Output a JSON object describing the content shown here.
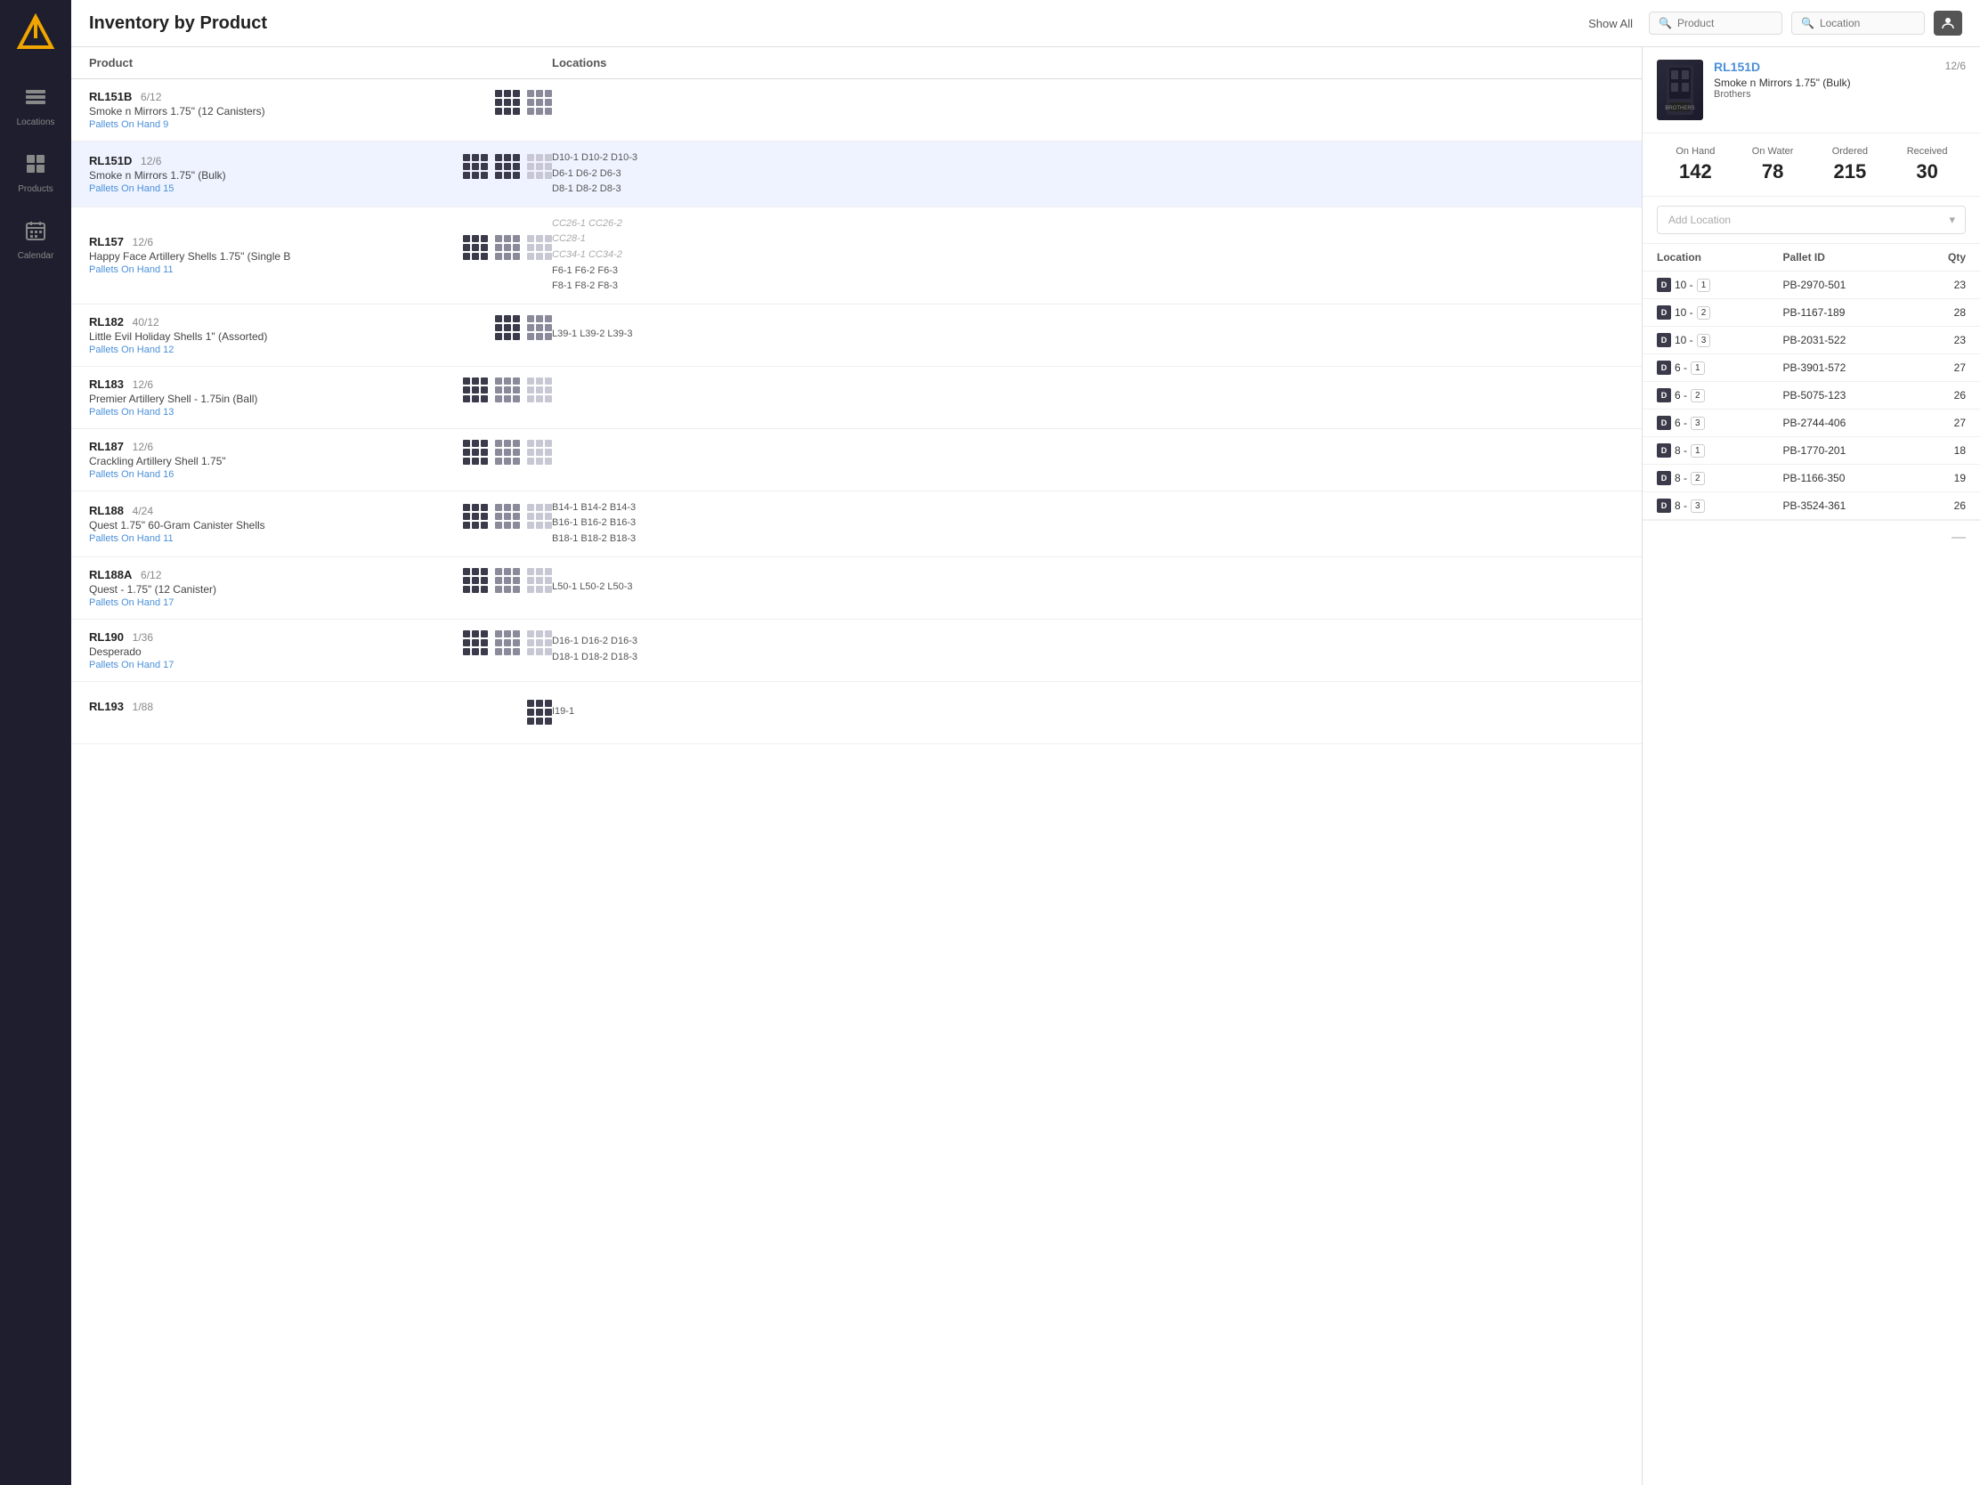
{
  "app": {
    "title": "Inventory by Product",
    "show_all_label": "Show All"
  },
  "header": {
    "product_placeholder": "Product",
    "location_placeholder": "Location"
  },
  "sidebar": {
    "logo_alt": "Logo",
    "items": [
      {
        "id": "locations",
        "label": "Locations",
        "icon": "⬡"
      },
      {
        "id": "products",
        "label": "Products",
        "icon": "⬡"
      },
      {
        "id": "calendar",
        "label": "Calendar",
        "icon": "▦"
      }
    ]
  },
  "table": {
    "col_product": "Product",
    "col_locations": "Locations"
  },
  "products": [
    {
      "code": "RL151B",
      "ratio": "6/12",
      "name": "Smoke n Mirrors 1.75\" (12 Canisters)",
      "pallets": "Pallets On Hand 9",
      "locations": [],
      "grids": [
        "dark",
        "med",
        "empty"
      ]
    },
    {
      "code": "RL151D",
      "ratio": "12/6",
      "name": "Smoke n Mirrors 1.75\" (Bulk)",
      "pallets": "Pallets On Hand 15",
      "locations": [
        "D10-1 D10-2 D10-3",
        "D6-1 D6-2 D6-3",
        "D8-1 D8-2 D8-3"
      ],
      "grids": [
        "dark",
        "dark",
        "light"
      ],
      "selected": true
    },
    {
      "code": "RL157",
      "ratio": "12/6",
      "name": "Happy Face Artillery Shells 1.75\" (Single B",
      "pallets": "Pallets On Hand 11",
      "locations": [
        "CC26-1 CC26-2",
        "CC28-1",
        "CC34-1 CC34-2",
        "F6-1 F6-2 F6-3",
        "F8-1 F8-2 F8-3"
      ],
      "location_cc": [
        true,
        true,
        true,
        false,
        false
      ],
      "grids": [
        "dark",
        "med",
        "light"
      ]
    },
    {
      "code": "RL182",
      "ratio": "40/12",
      "name": "Little Evil Holiday Shells 1\" (Assorted)",
      "pallets": "Pallets On Hand 12",
      "locations": [
        "L39-1 L39-2 L39-3"
      ],
      "grids": [
        "dark",
        "med",
        "empty"
      ]
    },
    {
      "code": "RL183",
      "ratio": "12/6",
      "name": "Premier Artillery Shell - 1.75in (Ball)",
      "pallets": "Pallets On Hand 13",
      "locations": [],
      "grids": [
        "dark",
        "med",
        "light"
      ]
    },
    {
      "code": "RL187",
      "ratio": "12/6",
      "name": "Crackling Artillery Shell 1.75\"",
      "pallets": "Pallets On Hand 16",
      "locations": [],
      "grids": [
        "dark",
        "med",
        "light"
      ]
    },
    {
      "code": "RL188",
      "ratio": "4/24",
      "name": "Quest 1.75\" 60-Gram Canister Shells",
      "pallets": "Pallets On Hand 11",
      "locations": [
        "B14-1 B14-2 B14-3",
        "B16-1 B16-2 B16-3",
        "B18-1 B18-2 B18-3"
      ],
      "grids": [
        "dark",
        "med",
        "light"
      ]
    },
    {
      "code": "RL188A",
      "ratio": "6/12",
      "name": "Quest - 1.75\" (12 Canister)",
      "pallets": "Pallets On Hand 17",
      "locations": [
        "L50-1 L50-2 L50-3"
      ],
      "grids": [
        "dark",
        "med",
        "light"
      ]
    },
    {
      "code": "RL190",
      "ratio": "1/36",
      "name": "Desperado",
      "pallets": "Pallets On Hand 17",
      "locations": [
        "D16-1 D16-2 D16-3",
        "D18-1 D18-2 D18-3"
      ],
      "grids": [
        "dark",
        "med",
        "light"
      ]
    },
    {
      "code": "RL193",
      "ratio": "1/88",
      "name": "",
      "pallets": "",
      "locations": [
        "I19-1"
      ],
      "grids": [
        "dark",
        "med",
        "empty"
      ]
    }
  ],
  "detail": {
    "code": "RL151D",
    "ratio": "12/6",
    "name": "Smoke n Mirrors 1.75\" (Bulk)",
    "sub": "Brothers",
    "on_hand_label": "On Hand",
    "on_water_label": "On Water",
    "ordered_label": "Ordered",
    "received_label": "Received",
    "on_hand_value": "142",
    "on_water_value": "78",
    "ordered_value": "215",
    "received_value": "30",
    "add_location_placeholder": "Add Location",
    "location_col": "Location",
    "pallet_col": "Pallet ID",
    "qty_col": "Qty",
    "rows": [
      {
        "loc_prefix": "D",
        "loc_num": "10",
        "loc_sub": "1",
        "pallet": "PB-2970-501",
        "qty": "23"
      },
      {
        "loc_prefix": "D",
        "loc_num": "10",
        "loc_sub": "2",
        "pallet": "PB-1167-189",
        "qty": "28"
      },
      {
        "loc_prefix": "D",
        "loc_num": "10",
        "loc_sub": "3",
        "pallet": "PB-2031-522",
        "qty": "23"
      },
      {
        "loc_prefix": "D",
        "loc_num": "6",
        "loc_sub": "1",
        "pallet": "PB-3901-572",
        "qty": "27"
      },
      {
        "loc_prefix": "D",
        "loc_num": "6",
        "loc_sub": "2",
        "pallet": "PB-5075-123",
        "qty": "26"
      },
      {
        "loc_prefix": "D",
        "loc_num": "6",
        "loc_sub": "3",
        "pallet": "PB-2744-406",
        "qty": "27"
      },
      {
        "loc_prefix": "D",
        "loc_num": "8",
        "loc_sub": "1",
        "pallet": "PB-1770-201",
        "qty": "18"
      },
      {
        "loc_prefix": "D",
        "loc_num": "8",
        "loc_sub": "2",
        "pallet": "PB-1166-350",
        "qty": "19"
      },
      {
        "loc_prefix": "D",
        "loc_num": "8",
        "loc_sub": "3",
        "pallet": "PB-3524-361",
        "qty": "26"
      }
    ],
    "footer_icon": "—"
  }
}
